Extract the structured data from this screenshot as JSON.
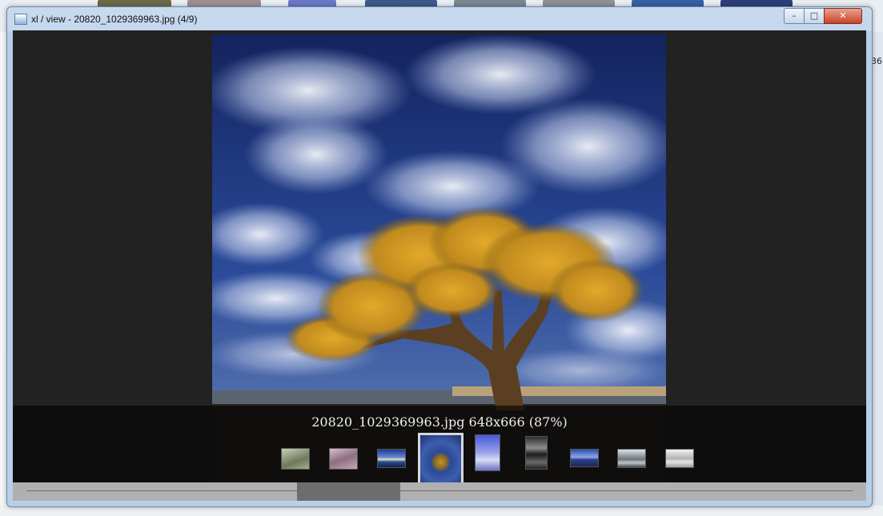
{
  "window": {
    "title": "xl / view - 20820_1029369963.jpg (4/9)",
    "minimize_glyph": "–",
    "maximize_glyph": "□",
    "close_glyph": "✕",
    "icon": "image-viewer-icon"
  },
  "background": {
    "partial_text": "36"
  },
  "viewer": {
    "filename": "20820_1029369963.jpg",
    "dimensions": "648x666",
    "zoom": "(87%)",
    "current_index": 4,
    "total": 9
  },
  "thumbnails": [
    {
      "name": "thumb-1",
      "current": false,
      "scene": "willow tree"
    },
    {
      "name": "thumb-2",
      "current": false,
      "scene": "pink blossoms"
    },
    {
      "name": "thumb-3",
      "current": false,
      "scene": "sunset lake"
    },
    {
      "name": "thumb-4",
      "current": true,
      "scene": "tree under clouds"
    },
    {
      "name": "thumb-5",
      "current": false,
      "scene": "blue mist"
    },
    {
      "name": "thumb-6",
      "current": false,
      "scene": "dark reflection"
    },
    {
      "name": "thumb-7",
      "current": false,
      "scene": "blue mountains"
    },
    {
      "name": "thumb-8",
      "current": false,
      "scene": "misty landscape"
    },
    {
      "name": "thumb-9",
      "current": false,
      "scene": "grey fog"
    }
  ],
  "colors": {
    "client_bg": "#222222",
    "caption": "#eeeeee",
    "current_thumb_border": "#d8d8d8"
  }
}
